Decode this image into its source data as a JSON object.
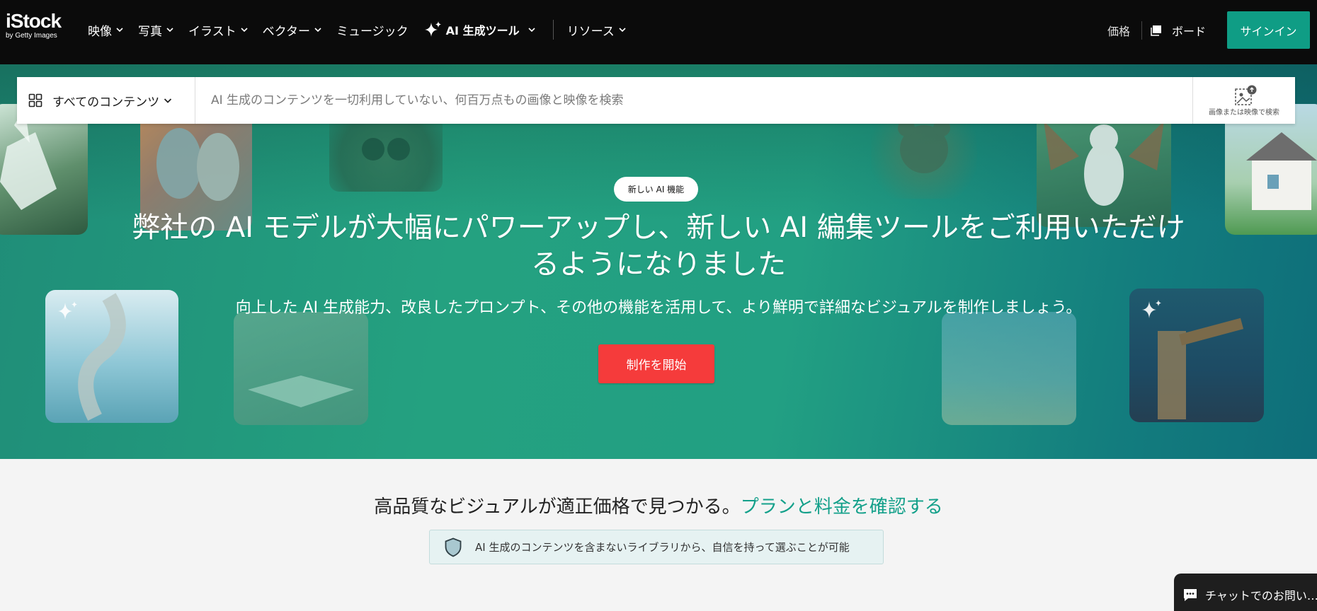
{
  "brand": {
    "name": "iStock",
    "tagline": "by Getty Images"
  },
  "nav": {
    "items": [
      {
        "label": "映像"
      },
      {
        "label": "写真"
      },
      {
        "label": "イラスト"
      },
      {
        "label": "ベクター"
      },
      {
        "label": "ミュージック"
      },
      {
        "label": "AI 生成ツール"
      },
      {
        "label": "リソース"
      }
    ],
    "price": "価格",
    "board": "ボード",
    "signin": "サインイン"
  },
  "search": {
    "filter_label": "すべてのコンテンツ",
    "placeholder": "AI 生成のコンテンツを一切利用していない、何百万点もの画像と映像を検索",
    "visual_search_label": "画像または映像で検索"
  },
  "hero": {
    "badge": "新しい AI 機能",
    "headline": "弊社の AI モデルが大幅にパワーアップし、新しい AI 編集ツールをご利用いただけるようになりました",
    "subline": "向上した AI 生成能力、改良したプロンプト、その他の機能を活用して、より鮮明で詳細なビジュアルを制作しましょう。",
    "cta": "制作を開始"
  },
  "pricing": {
    "text": "高品質なビジュアルが適正価格で見つかる。",
    "link": "プランと料金を確認する"
  },
  "trust_note": "AI 生成のコンテンツを含まないライブラリから、自信を持って選ぶことが可能",
  "chat": {
    "label": "チャットでのお問い…"
  },
  "colors": {
    "accent": "#0f9d85",
    "cta": "#f53b3b",
    "nav_bg": "#0b0b0b"
  }
}
